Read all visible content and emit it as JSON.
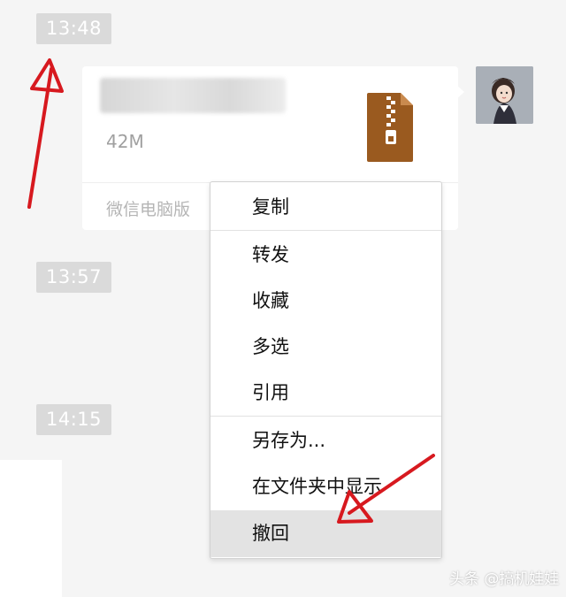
{
  "timestamps": [
    "13:48",
    "13:57",
    "14:15"
  ],
  "file_message": {
    "file_size": "42M",
    "source": "微信电脑版",
    "file_icon": "zip-archive-icon",
    "icon_color": "#9a5a1f"
  },
  "context_menu": {
    "items": [
      "复制",
      "转发",
      "收藏",
      "多选",
      "引用",
      "另存为...",
      "在文件夹中显示",
      "撤回"
    ],
    "highlighted": "撤回"
  },
  "watermark": "头条 @搞机娃娃",
  "colors": {
    "annotation_arrow": "#d7191f",
    "timestamp_bg": "#dadada",
    "menu_hover": "#e3e3e3"
  }
}
